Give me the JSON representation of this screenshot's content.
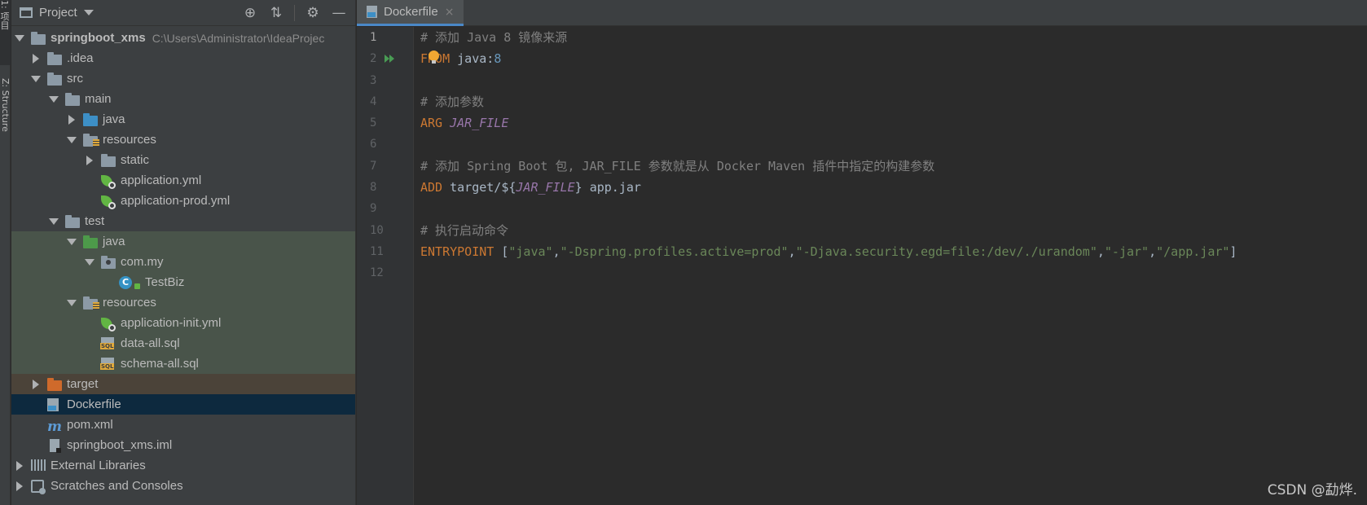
{
  "tool_strip": {
    "project_tab": "1: 项目",
    "structure_tab": "Z: Structure"
  },
  "project_panel": {
    "title": "Project",
    "toolbar_icons": [
      "locate-icon",
      "collapse-icon",
      "gear-icon",
      "minimize-icon"
    ],
    "tree": {
      "root_name": "springboot_xms",
      "root_path": "C:\\Users\\Administrator\\IdeaProjec",
      "idea": ".idea",
      "src": "src",
      "main": "main",
      "main_java": "java",
      "main_resources": "resources",
      "static": "static",
      "app_yml": "application.yml",
      "app_prod_yml": "application-prod.yml",
      "test": "test",
      "test_java": "java",
      "com_my": "com.my",
      "testbiz": "TestBiz",
      "test_resources": "resources",
      "app_init_yml": "application-init.yml",
      "data_sql": "data-all.sql",
      "schema_sql": "schema-all.sql",
      "target": "target",
      "dockerfile": "Dockerfile",
      "pom": "pom.xml",
      "iml": "springboot_xms.iml",
      "ext_libs": "External Libraries",
      "scratches": "Scratches and Consoles"
    }
  },
  "editor": {
    "tab_name": "Dockerfile",
    "tab_close": "×",
    "line_numbers": [
      "1",
      "2",
      "3",
      "4",
      "5",
      "6",
      "7",
      "8",
      "9",
      "10",
      "11",
      "12"
    ],
    "code": {
      "l1": "# 添加 Java 8 镜像来源",
      "l2_kw": "FROM",
      "l2_img": " java:",
      "l2_ver": "8",
      "l4": "# 添加参数",
      "l5_kw": "ARG",
      "l5_var": "JAR_FILE",
      "l7": "# 添加 Spring Boot 包, JAR_FILE 参数就是从 Docker Maven 插件中指定的构建参数",
      "l8_kw": "ADD",
      "l8_a": " target/${",
      "l8_var": "JAR_FILE",
      "l8_b": "} app.jar",
      "l10": "# 执行启动命令",
      "l11_kw": "ENTRYPOINT",
      "l11_open": " [",
      "l11_s1": "\"java\"",
      "l11_s2": "\"-Dspring.profiles.active=prod\"",
      "l11_s3": "\"-Djava.security.egd=file:/dev/./urandom\"",
      "l11_s4": "\"-jar\"",
      "l11_s5": "\"/app.jar\"",
      "l11_comma": ",",
      "l11_close": "]"
    }
  },
  "watermark": "CSDN @勐烨."
}
